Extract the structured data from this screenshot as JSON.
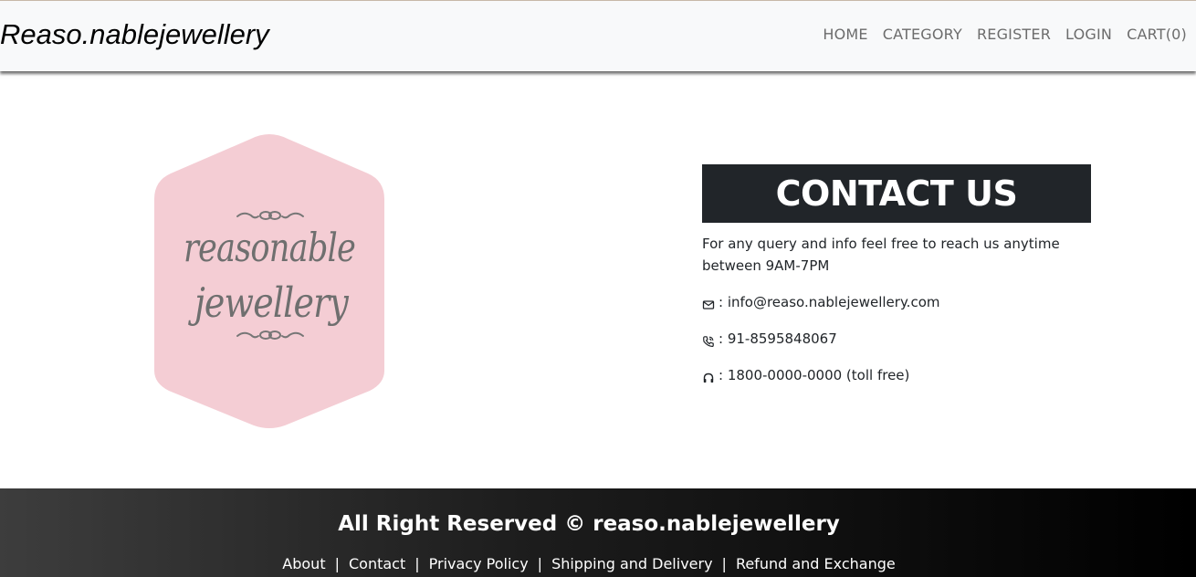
{
  "navbar": {
    "brand": "Reaso.nablejewellery",
    "links": [
      {
        "label": "HOME"
      },
      {
        "label": "CATEGORY"
      },
      {
        "label": "REGISTER"
      },
      {
        "label": "LOGIN"
      },
      {
        "label": "CART(0)"
      }
    ]
  },
  "logo": {
    "line1": "reasonable",
    "line2": "jewellery",
    "badge_color": "#f4cdd4",
    "text_color": "#6f6f6f"
  },
  "contact": {
    "heading": "CONTACT US",
    "intro": "For any query and info feel free to reach us anytime between 9AM-7PM",
    "email": ": info@reaso.nablejewellery.com",
    "phone": ": 91-8595848067",
    "tollfree": ": 1800-0000-0000 (toll free)",
    "icons": {
      "email": "envelope-icon",
      "phone": "phone-icon",
      "tollfree": "headset-icon"
    }
  },
  "footer": {
    "title": "All Right Reserved © reaso.nablejewellery",
    "links": [
      {
        "label": "About"
      },
      {
        "label": "Contact"
      },
      {
        "label": "Privacy Policy"
      },
      {
        "label": "Shipping and Delivery"
      },
      {
        "label": "Refund and Exchange"
      }
    ],
    "separator": "|"
  },
  "colors": {
    "nav_bg": "#f8f9fa",
    "heading_bg": "#212529",
    "footer_dark": "#000000",
    "footer_light": "#3d3d3d"
  }
}
